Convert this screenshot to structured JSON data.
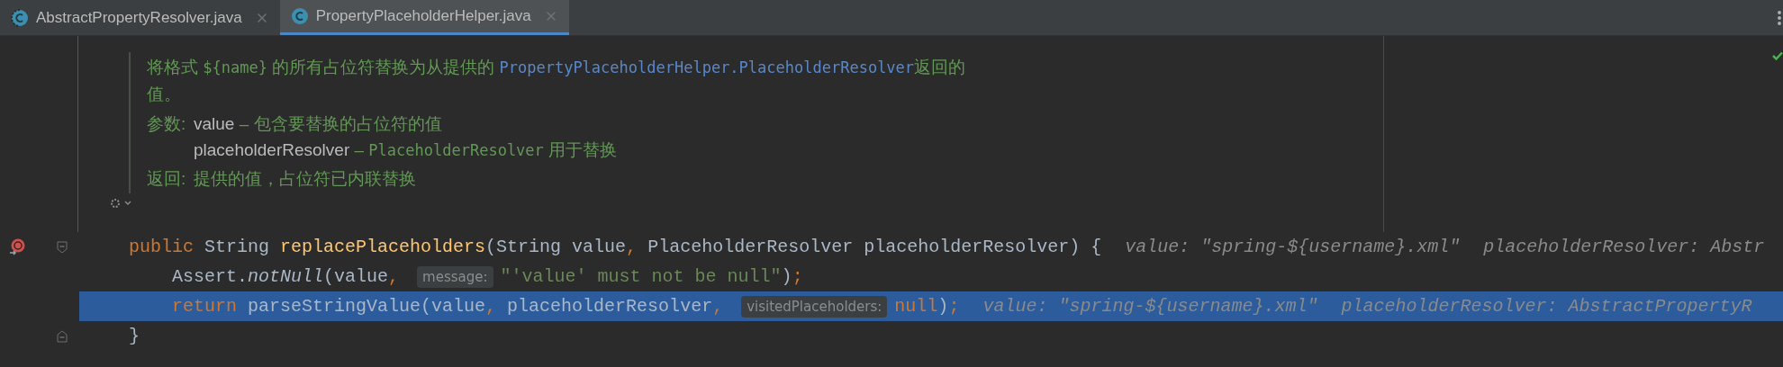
{
  "tabs": [
    {
      "label": "AbstractPropertyResolver.java",
      "kind": "abstract-class",
      "selected": false
    },
    {
      "label": "PropertyPlaceholderHelper.java",
      "kind": "class",
      "selected": true
    }
  ],
  "doc": {
    "description": [
      {
        "kind": "text",
        "text": "将格式 "
      },
      {
        "kind": "code",
        "text": "${name}"
      },
      {
        "kind": "text",
        "text": " 的所有占位符替换为从提供的 "
      },
      {
        "kind": "link",
        "text": "PropertyPlaceholderHelper.PlaceholderResolver"
      },
      {
        "kind": "text",
        "text": "返回的值。"
      }
    ],
    "params_label": "参数:",
    "params": [
      {
        "name": "value",
        "dash": "–",
        "description": [
          {
            "kind": "text",
            "text": "包含要替换的占位符的值"
          }
        ]
      },
      {
        "name": "placeholderResolver",
        "dash": "–",
        "description": [
          {
            "kind": "code",
            "text": "PlaceholderResolver"
          },
          {
            "kind": "text",
            "text": " 用于替换"
          }
        ]
      }
    ],
    "returns_label": "返回:",
    "returns": "提供的值，占位符已内联替换"
  },
  "lines": [
    {
      "breakpoint": true,
      "fold_start": true,
      "fold_end": false,
      "current": false,
      "segments": [
        {
          "kind": "keyword",
          "text": "public "
        },
        {
          "kind": "plain",
          "text": "String "
        },
        {
          "kind": "method",
          "text": "replacePlaceholders"
        },
        {
          "kind": "plain",
          "text": "(String value"
        },
        {
          "kind": "keyword",
          "text": ", "
        },
        {
          "kind": "plain",
          "text": "PlaceholderResolver placeholderResolver) {"
        },
        {
          "kind": "debug",
          "text": "value: \"spring-${username}.xml\""
        },
        {
          "kind": "debug",
          "text": "placeholderResolver: Abstr"
        }
      ]
    },
    {
      "breakpoint": false,
      "fold_start": false,
      "fold_end": false,
      "current": false,
      "segments": [
        {
          "kind": "plain",
          "text": "    Assert."
        },
        {
          "kind": "static",
          "text": "notNull"
        },
        {
          "kind": "plain",
          "text": "(value"
        },
        {
          "kind": "keyword",
          "text": ", "
        },
        {
          "kind": "hint",
          "text": "message:"
        },
        {
          "kind": "string",
          "text": "\"'value' must not be null\""
        },
        {
          "kind": "plain",
          "text": ")"
        },
        {
          "kind": "keyword",
          "text": ";"
        }
      ]
    },
    {
      "breakpoint": false,
      "fold_start": false,
      "fold_end": false,
      "current": true,
      "segments": [
        {
          "kind": "keyword",
          "text": "    return "
        },
        {
          "kind": "plain",
          "text": "parseStringValue(value"
        },
        {
          "kind": "keyword",
          "text": ", "
        },
        {
          "kind": "plain",
          "text": "placeholderResolver"
        },
        {
          "kind": "keyword",
          "text": ", "
        },
        {
          "kind": "hint",
          "text": "visitedPlaceholders:"
        },
        {
          "kind": "keyword",
          "text": "null"
        },
        {
          "kind": "plain",
          "text": ")"
        },
        {
          "kind": "keyword",
          "text": ";"
        },
        {
          "kind": "debug",
          "text": "value: \"spring-${username}.xml\""
        },
        {
          "kind": "debug",
          "text": "placeholderResolver: AbstractPropertyR"
        }
      ]
    },
    {
      "breakpoint": false,
      "fold_start": false,
      "fold_end": true,
      "current": false,
      "segments": [
        {
          "kind": "plain",
          "text": "}"
        }
      ]
    }
  ]
}
